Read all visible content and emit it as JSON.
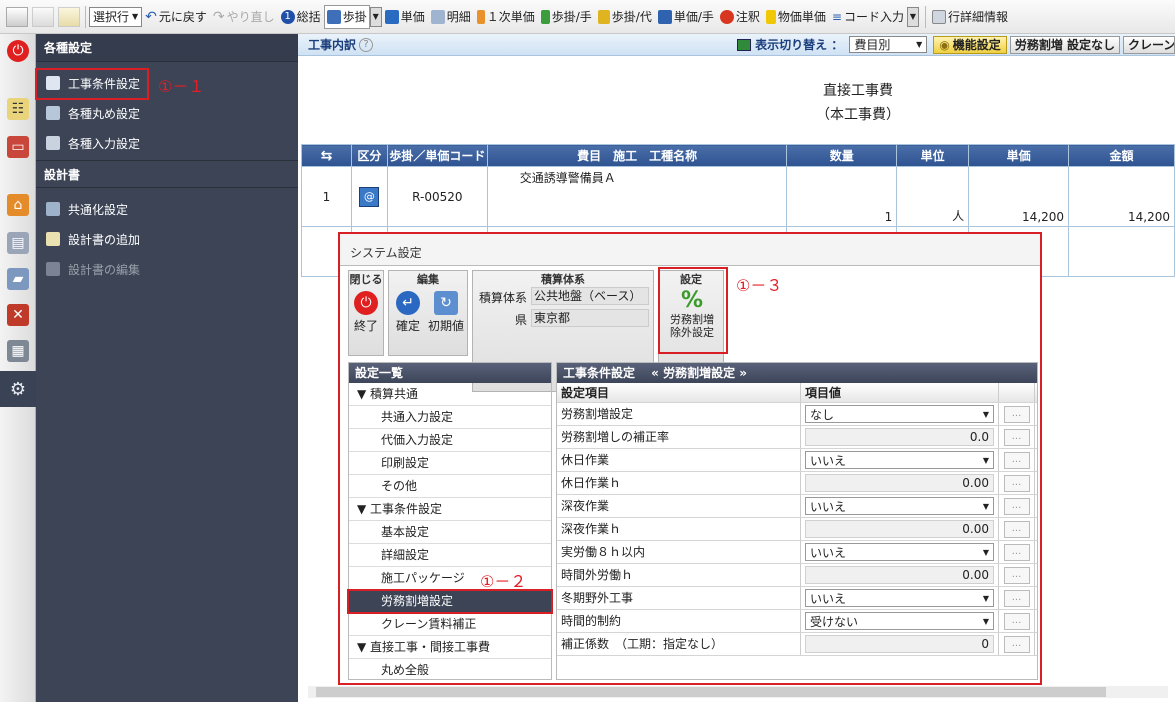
{
  "toolbar": {
    "select_row": "選択行",
    "undo": "元に戻す",
    "redo": "やり直し",
    "summary": "総括",
    "ayumi": "歩掛",
    "tanka": "単価",
    "meisai": "明細",
    "first_tanka": "１次単価",
    "ayumi_te": "歩掛/手",
    "ayumi_dai": "歩掛/代",
    "tanka_te": "単価/手",
    "chuushaku": "注釈",
    "bukka_tanka": "物価単価",
    "code_input": "コード入力",
    "row_detail": "行詳細情報"
  },
  "sidebar": {
    "section1": "各種設定",
    "items1": [
      {
        "label": "工事条件設定"
      },
      {
        "label": "各種丸め設定"
      },
      {
        "label": "各種入力設定"
      }
    ],
    "section2": "設計書",
    "items2": [
      {
        "label": "共通化設定"
      },
      {
        "label": "設計書の追加"
      },
      {
        "label": "設計書の編集"
      }
    ]
  },
  "annotations": {
    "a1": "①－１",
    "a2": "①－２",
    "a3": "①－３"
  },
  "main": {
    "title": "工事内訳",
    "help": "?",
    "display_switch": "表示切り替え ：",
    "display_value": "費目別",
    "btn_func": "機能設定",
    "btn_labor": "労務割増 設定なし",
    "btn_crane": "クレーン",
    "doc_title": "直接工事費",
    "doc_subtitle": "（本工事費）",
    "columns": [
      "区分",
      "歩掛／単価コード",
      "費目　施工　工種名称",
      "数量",
      "単位",
      "単価",
      "金額"
    ],
    "row": {
      "no": "1",
      "code": "R-00520",
      "name": "交通誘導警備員Ａ",
      "qty": "1",
      "unit": "人",
      "price": "14,200",
      "amount": "14,200"
    }
  },
  "dialog": {
    "title": "システム設定",
    "grp_close": "閉じる",
    "btn_exit": "終了",
    "grp_edit": "編集",
    "btn_confirm": "確定",
    "btn_init": "初期値",
    "grp_system": "積算体系",
    "system_label": "積算体系",
    "system_value": "公共地盤（ベース）",
    "pref_label": "県",
    "pref_value": "東京都",
    "grp_settings": "設定",
    "btn_labor_line1": "労務割増",
    "btn_labor_line2": "除外設定",
    "list_header": "設定一覧",
    "tree": [
      {
        "label": "▼ 積算共通",
        "level": 0
      },
      {
        "label": "共通入力設定",
        "level": 1
      },
      {
        "label": "代価入力設定",
        "level": 1
      },
      {
        "label": "印刷設定",
        "level": 1
      },
      {
        "label": "その他",
        "level": 1
      },
      {
        "label": "▼ 工事条件設定",
        "level": 0
      },
      {
        "label": "基本設定",
        "level": 1
      },
      {
        "label": "詳細設定",
        "level": 1
      },
      {
        "label": "施工パッケージ",
        "level": 1
      },
      {
        "label": "労務割増設定",
        "level": 1,
        "selected": true
      },
      {
        "label": "クレーン賃料補正",
        "level": 1
      },
      {
        "label": "▼ 直接工事・間接工事費",
        "level": 0
      },
      {
        "label": "丸め全般",
        "level": 1
      }
    ],
    "settings_header": "工事条件設定　 « 労務割増設定 »",
    "col_item": "設定項目",
    "col_value": "項目値",
    "settings": [
      {
        "label": "労務割増設定",
        "value": "なし",
        "type": "dd"
      },
      {
        "label": "労務割増しの補正率",
        "value": "0.0",
        "type": "num"
      },
      {
        "label": "休日作業",
        "value": "いいえ",
        "type": "dd"
      },
      {
        "label": "休日作業ｈ",
        "value": "0.00",
        "type": "num"
      },
      {
        "label": "深夜作業",
        "value": "いいえ",
        "type": "dd"
      },
      {
        "label": "深夜作業ｈ",
        "value": "0.00",
        "type": "num"
      },
      {
        "label": "実労働８ｈ以内",
        "value": "いいえ",
        "type": "dd"
      },
      {
        "label": "時間外労働ｈ",
        "value": "0.00",
        "type": "num"
      },
      {
        "label": "冬期野外工事",
        "value": "いいえ",
        "type": "dd"
      },
      {
        "label": "時間的制約",
        "value": "受けない",
        "type": "dd"
      },
      {
        "label": "補正係数　（工期：指定なし）",
        "value": "0",
        "type": "num"
      }
    ],
    "ellipsis": "..."
  }
}
